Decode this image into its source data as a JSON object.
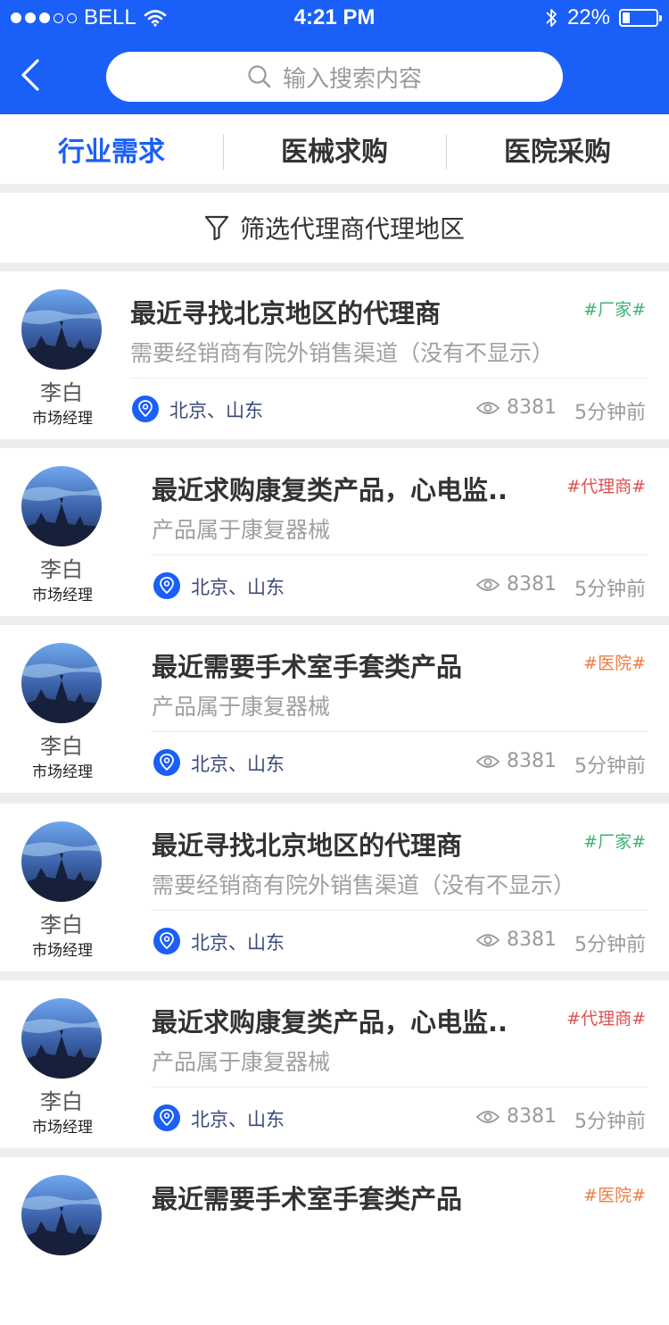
{
  "status_bar": {
    "carrier": "BELL",
    "time": "4:21 PM",
    "battery": "22%",
    "battery_level": 0.22
  },
  "search": {
    "placeholder": "输入搜索内容"
  },
  "tabs": [
    {
      "label": "行业需求",
      "active": true
    },
    {
      "label": "医械求购",
      "active": false
    },
    {
      "label": "医院采购",
      "active": false
    }
  ],
  "filter": {
    "label": "筛选代理商代理地区"
  },
  "colors": {
    "brand": "#1a5ff7",
    "tag_manufacturer": "#3cb371",
    "tag_agent": "#e05050",
    "tag_hospital": "#f07b40"
  },
  "posts": [
    {
      "name": "李白",
      "role": "市场经理",
      "title": "最近寻找北京地区的代理商",
      "tag": "#厂家#",
      "tag_type": "manufacturer",
      "desc": "需要经销商有院外销售渠道（没有不显示）",
      "location": "北京、山东",
      "views": "8381",
      "time": "5分钟前"
    },
    {
      "name": "李白",
      "role": "市场经理",
      "title": "最近求购康复类产品，心电监..",
      "tag": "#代理商#",
      "tag_type": "agent",
      "desc": "产品属于康复器械",
      "location": "北京、山东",
      "views": "8381",
      "time": "5分钟前"
    },
    {
      "name": "李白",
      "role": "市场经理",
      "title": "最近需要手术室手套类产品",
      "tag": "#医院#",
      "tag_type": "hospital",
      "desc": "产品属于康复器械",
      "location": "北京、山东",
      "views": "8381",
      "time": "5分钟前"
    },
    {
      "name": "李白",
      "role": "市场经理",
      "title": "最近寻找北京地区的代理商",
      "tag": "#厂家#",
      "tag_type": "manufacturer",
      "desc": "需要经销商有院外销售渠道（没有不显示）",
      "location": "北京、山东",
      "views": "8381",
      "time": "5分钟前"
    },
    {
      "name": "李白",
      "role": "市场经理",
      "title": "最近求购康复类产品，心电监..",
      "tag": "#代理商#",
      "tag_type": "agent",
      "desc": "产品属于康复器械",
      "location": "北京、山东",
      "views": "8381",
      "time": "5分钟前"
    },
    {
      "name": "",
      "role": "",
      "title": "最近需要手术室手套类产品",
      "tag": "#医院#",
      "tag_type": "hospital",
      "desc": "",
      "location": "",
      "views": "",
      "time": ""
    }
  ]
}
